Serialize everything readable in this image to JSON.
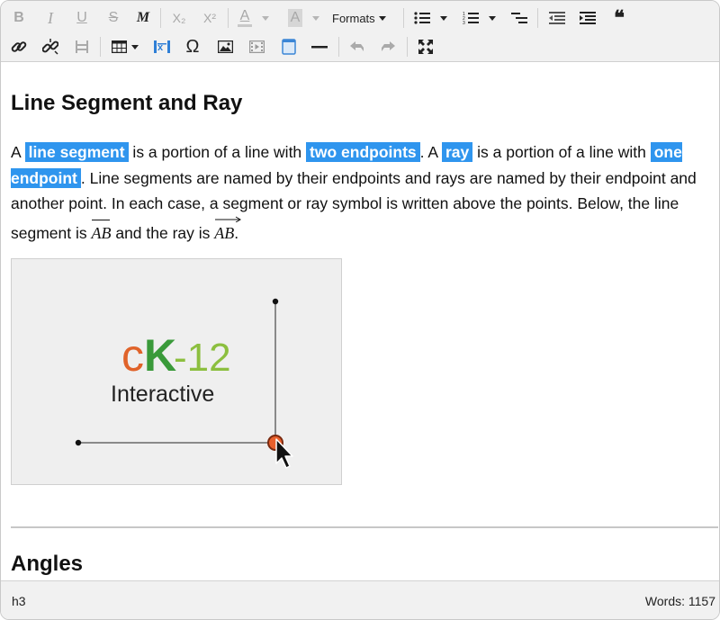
{
  "toolbar": {
    "formats_label": "Formats",
    "row1": [
      {
        "name": "bold-button",
        "icon": "bold-icon",
        "glyph": "B",
        "enabled": false
      },
      {
        "name": "italic-button",
        "icon": "italic-icon",
        "glyph": "I",
        "enabled": false
      },
      {
        "name": "underline-button",
        "icon": "underline-icon",
        "glyph": "U",
        "enabled": false
      },
      {
        "name": "strikethrough-button",
        "icon": "strikethrough-icon",
        "glyph": "S",
        "enabled": false
      },
      {
        "name": "math-button",
        "icon": "math-icon",
        "glyph": "M",
        "enabled": true
      },
      {
        "name": "subscript-button",
        "icon": "subscript-icon",
        "glyph": "X₂",
        "enabled": false
      },
      {
        "name": "superscript-button",
        "icon": "superscript-icon",
        "glyph": "X²",
        "enabled": false
      },
      {
        "name": "font-color-button",
        "icon": "font-color-icon",
        "glyph": "A",
        "enabled": false
      },
      {
        "name": "background-color-button",
        "icon": "background-color-icon",
        "glyph": "A",
        "enabled": false
      },
      {
        "name": "bullet-list-button",
        "icon": "bullet-list-icon",
        "enabled": true
      },
      {
        "name": "numbered-list-button",
        "icon": "numbered-list-icon",
        "enabled": true
      },
      {
        "name": "outdent-list-button",
        "icon": "outdent-icon",
        "enabled": true
      },
      {
        "name": "decrease-indent-button",
        "icon": "decrease-indent-icon",
        "enabled": true
      },
      {
        "name": "increase-indent-button",
        "icon": "increase-indent-icon",
        "enabled": true
      },
      {
        "name": "blockquote-button",
        "icon": "quote-icon",
        "glyph": "❝",
        "enabled": true
      }
    ],
    "row2": [
      {
        "name": "insert-link-button",
        "icon": "link-icon"
      },
      {
        "name": "remove-link-button",
        "icon": "unlink-icon"
      },
      {
        "name": "anchor-button",
        "icon": "anchor-icon"
      },
      {
        "name": "table-button",
        "icon": "table-icon"
      },
      {
        "name": "equation-button",
        "icon": "equation-icon"
      },
      {
        "name": "special-character-button",
        "icon": "omega-icon",
        "glyph": "Ω"
      },
      {
        "name": "insert-image-button",
        "icon": "image-icon"
      },
      {
        "name": "insert-video-button",
        "icon": "video-icon"
      },
      {
        "name": "insert-box-button",
        "icon": "box-icon"
      },
      {
        "name": "horizontal-rule-button",
        "icon": "horizontal-rule-icon"
      },
      {
        "name": "undo-button",
        "icon": "undo-icon"
      },
      {
        "name": "redo-button",
        "icon": "redo-icon"
      },
      {
        "name": "fullscreen-button",
        "icon": "fullscreen-icon"
      }
    ]
  },
  "content": {
    "title": "Line Segment and Ray",
    "paragraph": {
      "t1": "A ",
      "h1": "line segment",
      "t2": " is a portion of a line with ",
      "h2": "two endpoints",
      "t3": ". A ",
      "h3": "ray",
      "t4": " is a portion of a line with ",
      "h4": "one endpoint",
      "t5": ". Line segments are named by their endpoints and rays are named by their endpoint and another point. In each case, a segment or ray symbol is written above the points. Below, the line segment is ",
      "seg": "AB",
      "t6": " and the ray is ",
      "ray": "AB",
      "t7": "."
    },
    "figure": {
      "logo_c": "c",
      "logo_k": "K",
      "logo_num": "-12",
      "logo_sub": "Interactive",
      "colors": {
        "c": "#e0632a",
        "k": "#3a9a3a",
        "num": "#8cbf3f",
        "handle": "#e8602c"
      }
    },
    "next_title": "Angles"
  },
  "highlight_color": "#2f95ee",
  "status": {
    "path": "h3",
    "words": "Words: 1157"
  }
}
